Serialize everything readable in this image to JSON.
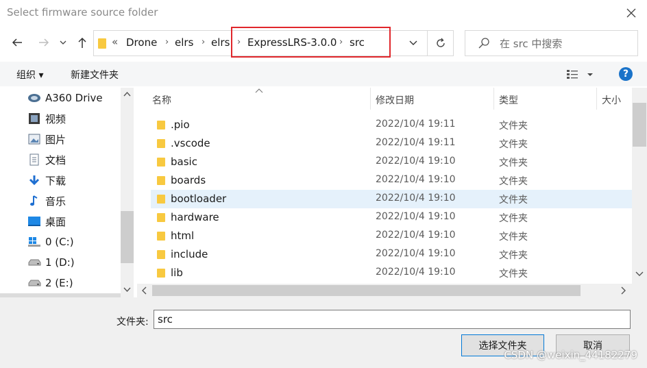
{
  "window": {
    "title": "Select firmware source folder"
  },
  "address": {
    "overflow": "«",
    "crumbs": [
      "Drone",
      "elrs",
      "elrs",
      "ExpressLRS-3.0.0",
      "src"
    ]
  },
  "search": {
    "placeholder": "在 src 中搜索"
  },
  "toolbar": {
    "organize": "组织 ▾",
    "new_folder": "新建文件夹"
  },
  "nav": {
    "items": [
      {
        "label": "A360 Drive",
        "icon": "cloud-drive-icon"
      },
      {
        "label": "视频",
        "icon": "video-icon"
      },
      {
        "label": "图片",
        "icon": "pictures-icon"
      },
      {
        "label": "文档",
        "icon": "documents-icon"
      },
      {
        "label": "下载",
        "icon": "download-icon"
      },
      {
        "label": "音乐",
        "icon": "music-icon"
      },
      {
        "label": "桌面",
        "icon": "desktop-icon"
      },
      {
        "label": "0 (C:)",
        "icon": "windows-drive-icon"
      },
      {
        "label": "1 (D:)",
        "icon": "drive-icon"
      },
      {
        "label": "2 (E:)",
        "icon": "drive-icon"
      }
    ]
  },
  "list": {
    "columns": {
      "name": "名称",
      "date": "修改日期",
      "type": "类型",
      "size": "大小"
    },
    "rows": [
      {
        "name": ".pio",
        "date": "2022/10/4 19:11",
        "type": "文件夹"
      },
      {
        "name": ".vscode",
        "date": "2022/10/4 19:11",
        "type": "文件夹"
      },
      {
        "name": "basic",
        "date": "2022/10/4 19:10",
        "type": "文件夹"
      },
      {
        "name": "boards",
        "date": "2022/10/4 19:10",
        "type": "文件夹"
      },
      {
        "name": "bootloader",
        "date": "2022/10/4 19:10",
        "type": "文件夹",
        "selected": true
      },
      {
        "name": "hardware",
        "date": "2022/10/4 19:10",
        "type": "文件夹"
      },
      {
        "name": "html",
        "date": "2022/10/4 19:10",
        "type": "文件夹"
      },
      {
        "name": "include",
        "date": "2022/10/4 19:10",
        "type": "文件夹"
      },
      {
        "name": "lib",
        "date": "2022/10/4 19:10",
        "type": "文件夹"
      }
    ]
  },
  "footer": {
    "folder_label": "文件夹:",
    "folder_value": "src",
    "select_button": "选择文件夹",
    "cancel_button": "取消"
  },
  "watermark": "CSDN @weixin_44182279",
  "colors": {
    "highlight": "#e0262b",
    "accent": "#0078d7",
    "folder": "#f8c940",
    "selection": "#e5f1fb"
  }
}
